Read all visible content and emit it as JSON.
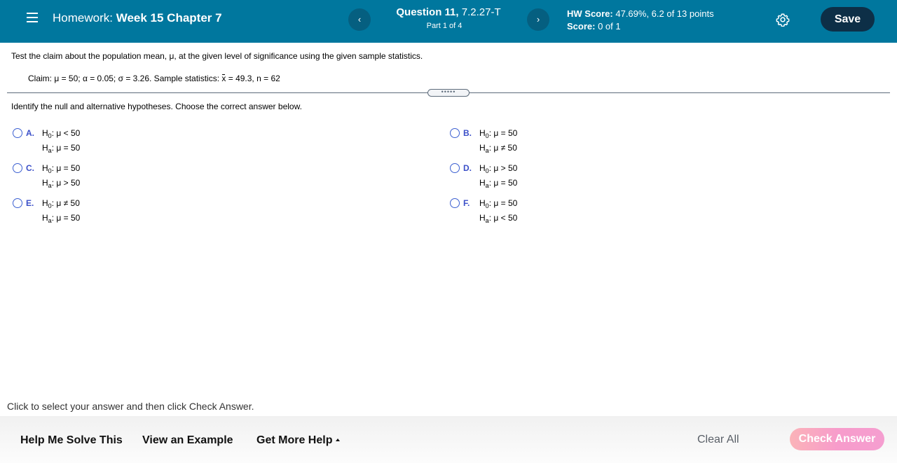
{
  "header": {
    "menu_icon": "hamburger-menu-icon",
    "homework_prefix": "Homework:",
    "homework_title": "Week 15 Chapter 7",
    "prev_icon": "‹",
    "next_icon": "›",
    "question_label": "Question 11,",
    "question_id": "7.2.27-T",
    "part": "Part 1 of 4",
    "hw_score_label": "HW Score:",
    "hw_score_value": "47.69%, 6.2 of 13 points",
    "score_label": "Score:",
    "score_value": "0 of 1",
    "settings_icon": "gear-icon",
    "save_label": "Save"
  },
  "question": {
    "prompt": "Test the claim about the population mean, μ, at the given level of significance using the given sample statistics.",
    "claim_prefix": "Claim: μ = 50; α = 0.05; σ = 3.26. Sample statistics: ",
    "xbar_symbol": "x",
    "claim_suffix": " = 49.3, n = 62",
    "expander_label": "•••••",
    "instruction": "Identify the null and alternative hypotheses. Choose the correct answer below."
  },
  "options": [
    {
      "letter": "A.",
      "h0": "μ < 50",
      "ha": "μ = 50"
    },
    {
      "letter": "B.",
      "h0": "μ = 50",
      "ha": "μ ≠ 50"
    },
    {
      "letter": "C.",
      "h0": "μ = 50",
      "ha": "μ > 50"
    },
    {
      "letter": "D.",
      "h0": "μ > 50",
      "ha": "μ = 50"
    },
    {
      "letter": "E.",
      "h0": "μ ≠ 50",
      "ha": "μ = 50"
    },
    {
      "letter": "F.",
      "h0": "μ = 50",
      "ha": "μ < 50"
    }
  ],
  "hyp": {
    "h": "H",
    "null_sub": "0",
    "alt_sub": "a",
    "colon": ": "
  },
  "footer": {
    "note": "Click to select your answer and then click Check Answer.",
    "help_me_solve": "Help Me Solve This",
    "view_example": "View an Example",
    "get_more_help": "Get More Help",
    "clear_all": "Clear All",
    "check_answer": "Check Answer"
  }
}
